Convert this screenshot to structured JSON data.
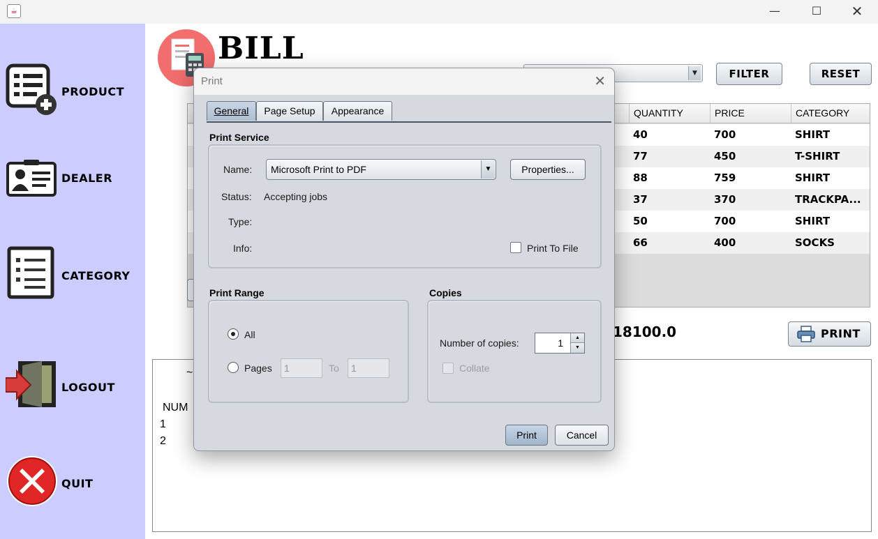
{
  "window": {
    "app_icon": "java-cup-icon",
    "minimize": "—",
    "maximize": "☐",
    "close": "✕"
  },
  "sidebar": {
    "items": [
      {
        "label": "PRODUCT",
        "icon": "product-list-add-icon"
      },
      {
        "label": "DEALER",
        "icon": "dealer-id-card-icon"
      },
      {
        "label": "CATEGORY",
        "icon": "category-list-icon"
      },
      {
        "label": "LOGOUT",
        "icon": "logout-door-icon"
      },
      {
        "label": "QUIT",
        "icon": "quit-x-icon"
      }
    ]
  },
  "header": {
    "title": "BILL",
    "logo": "bill-receipt-calculator-icon"
  },
  "toolbar": {
    "filter_label": "FILTER",
    "reset_label": "RESET"
  },
  "table": {
    "columns": [
      "QUANTITY",
      "PRICE",
      "CATEGORY"
    ],
    "rows": [
      [
        "40",
        "700",
        "SHIRT"
      ],
      [
        "77",
        "450",
        "T-SHIRT"
      ],
      [
        "88",
        "759",
        "SHIRT"
      ],
      [
        "37",
        "370",
        "TRACKPA..."
      ],
      [
        "50",
        "700",
        "SHIRT"
      ],
      [
        "66",
        "400",
        "SOCKS"
      ]
    ]
  },
  "total": "18100.0",
  "print_button": "PRINT",
  "bill_text": {
    "line1": "~",
    "header": "NUM",
    "row1": "1",
    "row2": "2"
  },
  "dialog": {
    "title": "Print",
    "tabs": [
      "General",
      "Page Setup",
      "Appearance"
    ],
    "print_service": {
      "title": "Print Service",
      "name_label": "Name:",
      "name_value": "Microsoft Print to PDF",
      "properties_label": "Properties...",
      "status_label": "Status:",
      "status_value": "Accepting jobs",
      "type_label": "Type:",
      "info_label": "Info:",
      "print_to_file_label": "Print To File"
    },
    "print_range": {
      "title": "Print Range",
      "all_label": "All",
      "pages_label": "Pages",
      "from_value": "1",
      "to_label": "To",
      "to_value": "1"
    },
    "copies": {
      "title": "Copies",
      "number_label": "Number of copies:",
      "number_value": "1",
      "collate_label": "Collate"
    },
    "print_label": "Print",
    "cancel_label": "Cancel"
  }
}
